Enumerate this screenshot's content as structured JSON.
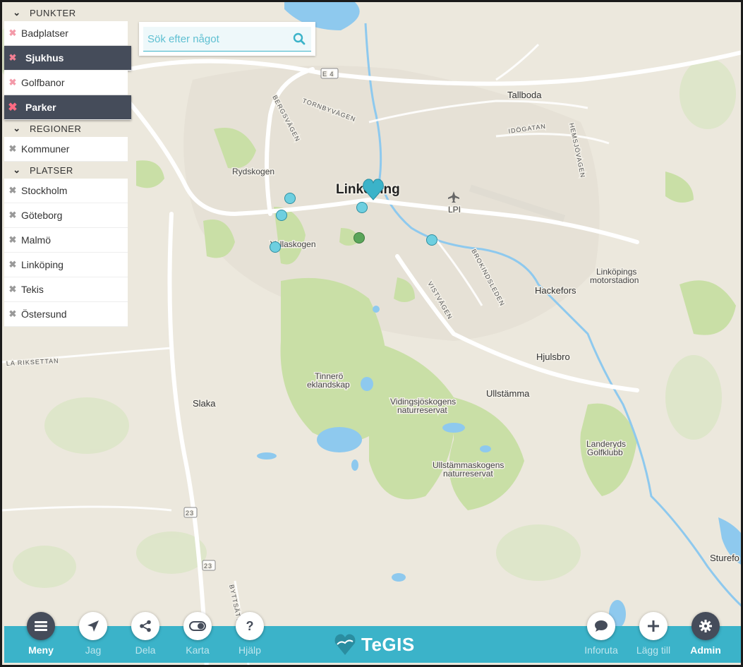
{
  "panel": {
    "sections": [
      {
        "title": "PUNKTER",
        "layers": [
          {
            "label": "Badplatser",
            "state": "pink"
          },
          {
            "label": "Sjukhus",
            "state": "active"
          },
          {
            "label": "Golfbanor",
            "state": "pink"
          },
          {
            "label": "Parker",
            "state": "active-strong"
          }
        ]
      },
      {
        "title": "REGIONER",
        "layers": [
          {
            "label": "Kommuner",
            "state": "normal"
          }
        ]
      },
      {
        "title": "PLATSER",
        "layers": [
          {
            "label": "Stockholm",
            "state": "normal"
          },
          {
            "label": "Göteborg",
            "state": "normal"
          },
          {
            "label": "Malmö",
            "state": "normal"
          },
          {
            "label": "Linköping",
            "state": "normal"
          },
          {
            "label": "Tekis",
            "state": "normal"
          },
          {
            "label": "Östersund",
            "state": "normal"
          }
        ]
      }
    ]
  },
  "search": {
    "placeholder": "Sök efter något",
    "value": "",
    "icon": "search-icon"
  },
  "map": {
    "labels": {
      "linkoping": "Linköping",
      "e4": "E 4",
      "tornbyvagen": "TORNBYVÄGEN",
      "bergsvagen": "BERGSVÄGEN",
      "tallboda": "Tallboda",
      "idogatan": "IDÖGATAN",
      "hemsjovagen": "HEMSJÖVAGEN",
      "rydskogen": "Rydskogen",
      "lpi": "LPI",
      "vallaskogen": "Vallaskogen",
      "brokindsleden": "BROKINDSLEDEN",
      "motorstadion1": "Linköpings",
      "motorstadion2": "motorstadion",
      "hackefors": "Hackefors",
      "vistvagen": "VISTVÄGEN",
      "hjulsbro": "Hjulsbro",
      "riksettan": "LA RIKSETTAN",
      "tinnero1": "Tinnerö",
      "tinnero2": "eklandskap",
      "vidingsjo1": "Vidingsjöskogens",
      "vidingsjo2": "naturreservat",
      "ullstamma": "Ullstämma",
      "slaka": "Slaka",
      "landeryd1": "Landeryds",
      "landeryd2": "Golfklubb",
      "ullstammaskog1": "Ullstämmaskogens",
      "ullstammaskog2": "naturreservat",
      "road23": "23",
      "bytsatt": "BYTTSÄTT",
      "sturefors": "Sturefo"
    },
    "colors": {
      "base": "#ece8dd",
      "park": "#c9dfa6",
      "water": "#8ec9ee",
      "road": "#ffffff",
      "marker": "#6ecfe0",
      "marker_green": "#5aa55a",
      "accent": "#3bb3c9"
    }
  },
  "bottom_bar": {
    "left_items": [
      {
        "label": "Meny",
        "icon": "menu-icon",
        "active": true
      },
      {
        "label": "Jag",
        "icon": "location-arrow-icon",
        "active": false
      },
      {
        "label": "Dela",
        "icon": "share-icon",
        "active": false
      },
      {
        "label": "Karta",
        "icon": "toggle-icon",
        "active": false
      },
      {
        "label": "Hjälp",
        "icon": "help-icon",
        "active": false
      }
    ],
    "brand": "TeGIS",
    "right_items": [
      {
        "label": "Inforuta",
        "icon": "chat-icon",
        "active": false
      },
      {
        "label": "Lägg till",
        "icon": "plus-icon",
        "active": false
      },
      {
        "label": "Admin",
        "icon": "gear-icon",
        "active": true
      }
    ]
  }
}
